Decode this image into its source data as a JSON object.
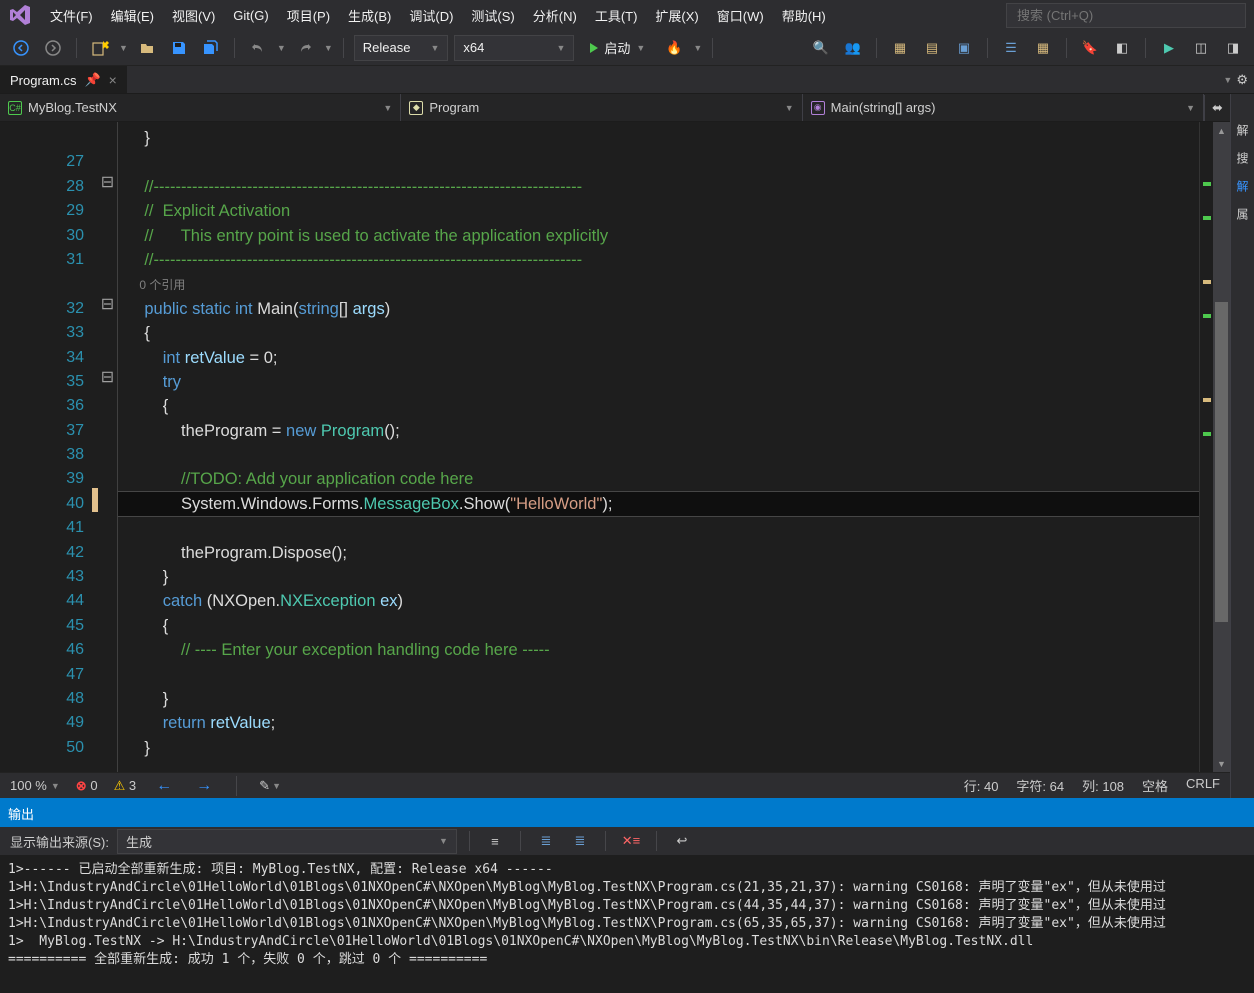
{
  "menu": {
    "file": "文件(F)",
    "edit": "编辑(E)",
    "view": "视图(V)",
    "git": "Git(G)",
    "project": "项目(P)",
    "build": "生成(B)",
    "debug": "调试(D)",
    "test": "测试(S)",
    "analyze": "分析(N)",
    "tools": "工具(T)",
    "extensions": "扩展(X)",
    "window": "窗口(W)",
    "help": "帮助(H)"
  },
  "search_placeholder": "搜索 (Ctrl+Q)",
  "toolbar": {
    "config": "Release",
    "platform": "x64",
    "start": "启动"
  },
  "tab": {
    "name": "Program.cs"
  },
  "nav": {
    "project": "MyBlog.TestNX",
    "class": "Program",
    "method": "Main(string[] args)"
  },
  "side_tabs": {
    "sol": "解",
    "search": "搜",
    "res1": "解",
    "prop": "属"
  },
  "gutter_lines": [
    "",
    "27",
    "28",
    "29",
    "30",
    "31",
    "",
    "32",
    "33",
    "34",
    "35",
    "36",
    "37",
    "38",
    "39",
    "40",
    "41",
    "42",
    "43",
    "44",
    "45",
    "46",
    "47",
    "48",
    "49",
    "50"
  ],
  "code": {
    "l27": "}",
    "l28": "//------------------------------------------------------------------------------",
    "l29": "//  Explicit Activation",
    "l30": "//      This entry point is used to activate the application explicitly",
    "l31": "//------------------------------------------------------------------------------",
    "refs": "0 个引用",
    "l32_kw1": "public",
    "l32_kw2": "static",
    "l32_kw3": "int",
    "l32_main": "Main",
    "l32_kw4": "string",
    "l32_args": "args",
    "l33": "{",
    "l34_kw": "int",
    "l34_var": "retValue",
    "l34_rest": " = 0;",
    "l35_kw": "try",
    "l36": "{",
    "l37_a": "theProgram = ",
    "l37_kw": "new",
    "l37_type": "Program",
    "l37_rest": "();",
    "l39": "//TODO: Add your application code here",
    "l40_a": "System.Windows.Forms.",
    "l40_b": "MessageBox",
    "l40_c": ".Show(",
    "l40_str": "\"HelloWorld\"",
    "l40_d": ");",
    "l42_a": "theProgram.Dispose();",
    "l43": "}",
    "l44_kw": "catch",
    "l44_ns": "NXOpen",
    "l44_type": "NXException",
    "l44_var": "ex",
    "l45": "{",
    "l46": "// ---- Enter your exception handling code here -----",
    "l47": "",
    "l48": "}",
    "l49_kw": "return",
    "l49_var": "retValue",
    "l50": "}"
  },
  "status": {
    "zoom": "100 %",
    "errors": "0",
    "warnings": "3",
    "line": "行: 40",
    "char": "字符: 64",
    "col": "列: 108",
    "ins": "空格",
    "eol": "CRLF"
  },
  "output": {
    "title": "输出",
    "source_label": "显示输出来源(S):",
    "source_value": "生成",
    "lines": [
      "1>------ 已启动全部重新生成: 项目: MyBlog.TestNX, 配置: Release x64 ------",
      "1>H:\\IndustryAndCircle\\01HelloWorld\\01Blogs\\01NXOpenC#\\NXOpen\\MyBlog\\MyBlog.TestNX\\Program.cs(21,35,21,37): warning CS0168: 声明了变量\"ex\"，但从未使用过",
      "1>H:\\IndustryAndCircle\\01HelloWorld\\01Blogs\\01NXOpenC#\\NXOpen\\MyBlog\\MyBlog.TestNX\\Program.cs(44,35,44,37): warning CS0168: 声明了变量\"ex\"，但从未使用过",
      "1>H:\\IndustryAndCircle\\01HelloWorld\\01Blogs\\01NXOpenC#\\NXOpen\\MyBlog\\MyBlog.TestNX\\Program.cs(65,35,65,37): warning CS0168: 声明了变量\"ex\"，但从未使用过",
      "1>  MyBlog.TestNX -> H:\\IndustryAndCircle\\01HelloWorld\\01Blogs\\01NXOpenC#\\NXOpen\\MyBlog\\MyBlog.TestNX\\bin\\Release\\MyBlog.TestNX.dll",
      "========== 全部重新生成: 成功 1 个，失败 0 个，跳过 0 个 =========="
    ]
  }
}
